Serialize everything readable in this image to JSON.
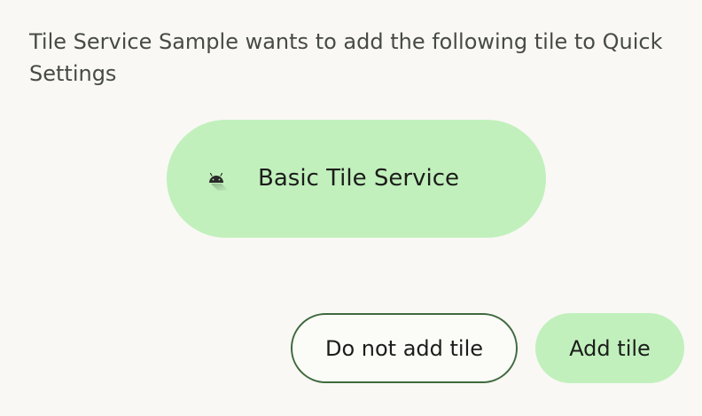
{
  "dialog": {
    "message": "Tile Service Sample wants to add the following tile to Quick Settings"
  },
  "tile": {
    "label": "Basic Tile Service",
    "icon": "android-icon",
    "background_color": "#c1f0bc"
  },
  "actions": {
    "cancel_label": "Do not add tile",
    "confirm_label": "Add tile",
    "outline_color": "#3f6a3d",
    "filled_color": "#c1f0bc"
  }
}
